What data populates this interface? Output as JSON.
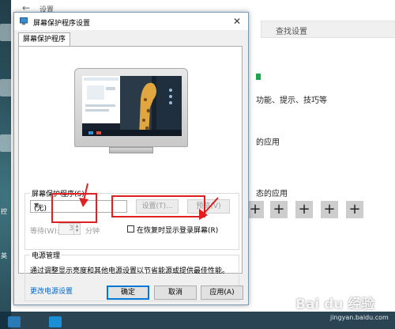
{
  "settings_window": {
    "title": "设置",
    "search_placeholder": "查找设置",
    "line_tips": "功能、提示、技巧等",
    "line_apps": "的应用",
    "line_more_apps": "态的应用",
    "plus_buttons": [
      "+",
      "+",
      "+",
      "+",
      "+",
      "+"
    ]
  },
  "desktop": {
    "left_labels": [
      "控",
      "英"
    ]
  },
  "dialog": {
    "title": "屏幕保护程序设置",
    "close_glyph": "✕",
    "tab_label": "屏幕保护程序",
    "screensaver": {
      "group_label": "屏幕保护程序(S)",
      "selected": "(无)",
      "settings_button": "设置(T)...",
      "preview_button": "预览(V)",
      "wait_label": "等待(W):",
      "wait_value": "3",
      "wait_unit": "分钟",
      "resume_label": "在恢复时显示登录屏幕(R)",
      "resume_checked": false
    },
    "power": {
      "group_label": "电源管理",
      "description": "通过调整显示亮度和其他电源设置以节省能源或提供最佳性能。",
      "link": "更改电源设置"
    },
    "buttons": {
      "ok": "确定",
      "cancel": "取消",
      "apply": "应用(A)"
    }
  },
  "watermark": {
    "brand": "Bai du 经验",
    "url": "jingyan.baidu.com"
  },
  "colors": {
    "accent_blue": "#0078d7",
    "annotation_red": "#e02020",
    "link_blue": "#0066cc"
  }
}
